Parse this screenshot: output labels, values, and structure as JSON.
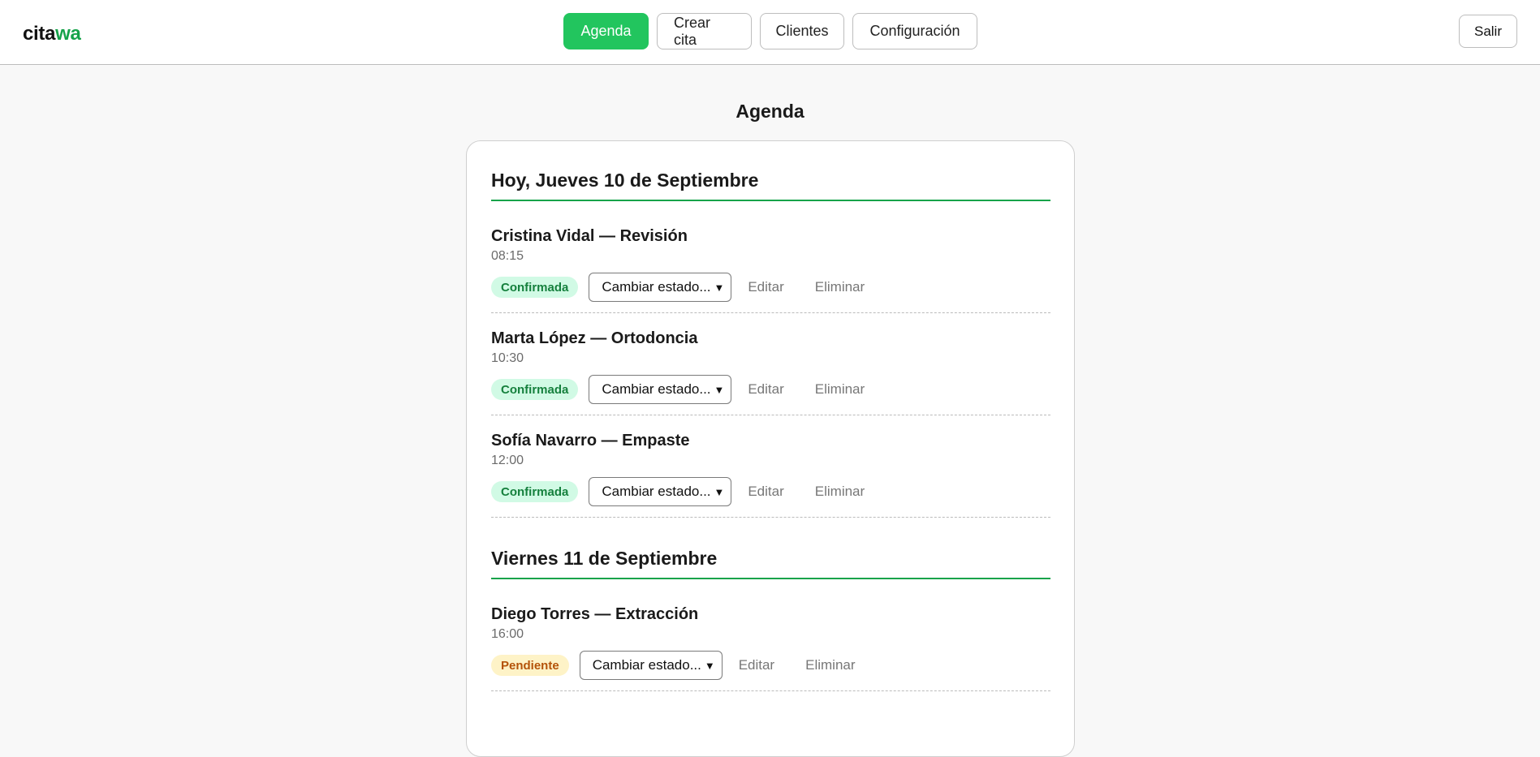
{
  "brand": {
    "part1": "cita",
    "part2": "wa"
  },
  "nav": {
    "agenda": "Agenda",
    "crear_cita": "Crear cita",
    "clientes": "Clientes",
    "configuracion": "Configuración",
    "logout": "Salir"
  },
  "page": {
    "title": "Agenda"
  },
  "colors": {
    "accent": "#16a34a",
    "primary_button": "#22c55e"
  },
  "days": [
    {
      "heading": "Hoy, Jueves 10 de Septiembre",
      "appointments": [
        {
          "title": "Cristina Vidal — Revisión",
          "time": "08:15",
          "status": "Confirmada",
          "select": "Cambiar estado...",
          "edit": "Editar",
          "delete": "Eliminar"
        },
        {
          "title": "Marta López — Ortodoncia",
          "time": "10:30",
          "status": "Confirmada",
          "select": "Cambiar estado...",
          "edit": "Editar",
          "delete": "Eliminar"
        },
        {
          "title": "Sofía Navarro — Empaste",
          "time": "12:00",
          "status": "Confirmada",
          "select": "Cambiar estado...",
          "edit": "Editar",
          "delete": "Eliminar"
        }
      ]
    },
    {
      "heading": "Viernes 11 de Septiembre",
      "appointments": [
        {
          "title": "Diego Torres — Extracción",
          "time": "16:00",
          "status": "Pendiente",
          "select": "Cambiar estado...",
          "edit": "Editar",
          "delete": "Eliminar"
        }
      ]
    }
  ]
}
